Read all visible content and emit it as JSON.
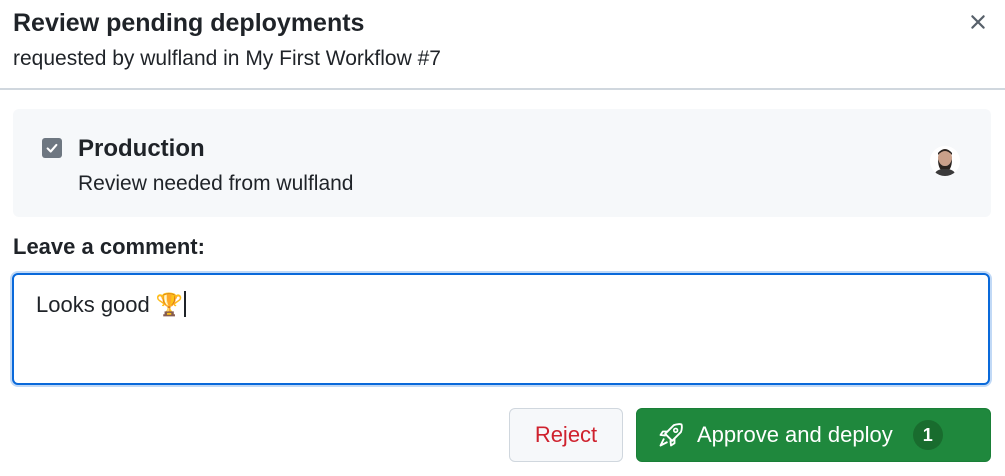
{
  "dialog": {
    "title": "Review pending deployments",
    "subtitle": "requested by wulfland in My First Workflow #7",
    "close_icon": "close-icon"
  },
  "environment": {
    "checked": true,
    "name": "Production",
    "description": "Review needed from wulfland",
    "avatar_icon": "user-avatar"
  },
  "comment": {
    "label": "Leave a comment:",
    "value": "Looks good 🏆"
  },
  "actions": {
    "reject_label": "Reject",
    "approve_label": "Approve and deploy",
    "approve_count": "1",
    "approve_icon": "rocket-icon"
  },
  "colors": {
    "approve": "#1f883d",
    "reject_text": "#cf222e",
    "focus_border": "#0969da"
  }
}
